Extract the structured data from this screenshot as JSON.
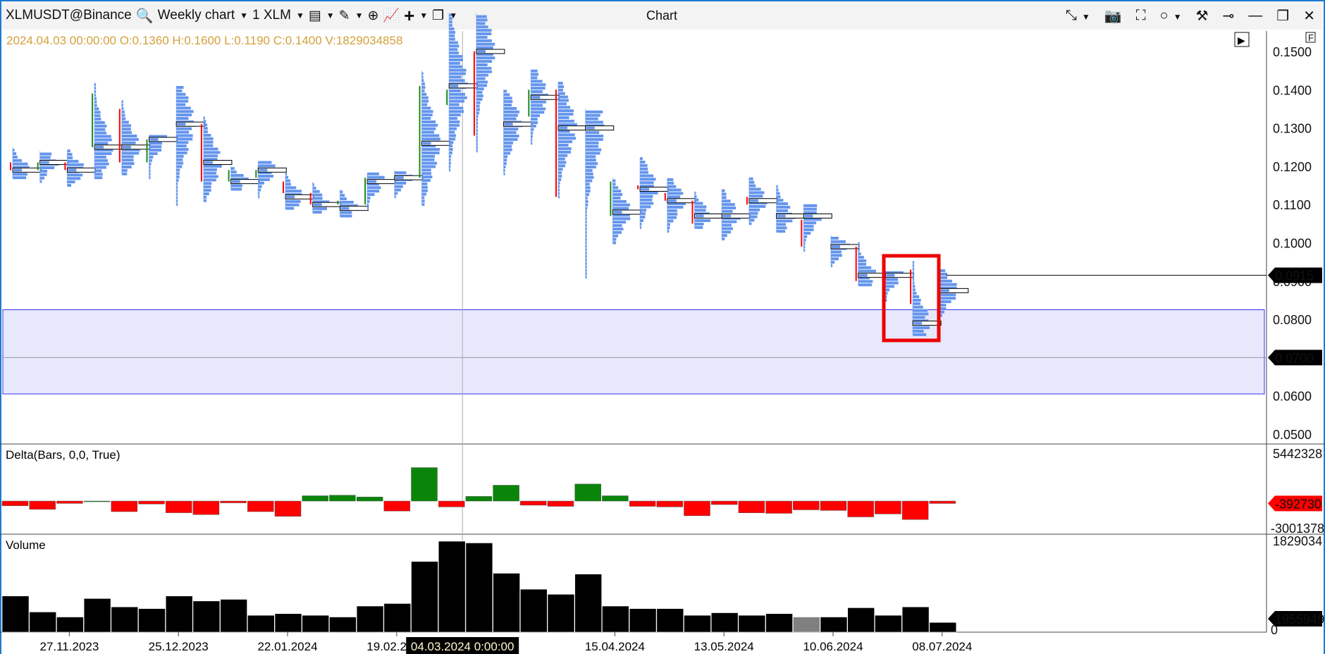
{
  "toolbar": {
    "symbol": "XLMUSDT@Binance",
    "timeframe": "Weekly chart",
    "quantity": "1 XLM",
    "title": "Chart"
  },
  "ohlc_readout": "2024.04.03 00:00:00 O:0.1360 H:0.1600 L:0.1190 C:0.1400 V:1829034858",
  "price_axis": {
    "ticks": [
      "0.1500",
      "0.1400",
      "0.1300",
      "0.1200",
      "0.1100",
      "0.1000",
      "0.0900",
      "0.0800",
      "0.0700",
      "0.0600",
      "0.0500"
    ],
    "last_price_label": "0.0915",
    "level_label": "0.0700"
  },
  "delta_pane": {
    "label": "Delta(Bars, 0,0, True)",
    "max_label": "5442328",
    "min_label": "-3001378",
    "last_label": "-392730"
  },
  "volume_pane": {
    "label": "Volume",
    "max_label": "1829034",
    "last_label": "1955949",
    "zero_label": "0"
  },
  "time_axis": {
    "labels": [
      "27.11.2023",
      "25.12.2023",
      "22.01.2024",
      "19.02.2024",
      "15.04.2024",
      "13.05.2024",
      "10.06.2024",
      "08.07.2024"
    ],
    "crosshair_label": "04.03.2024 0:00:00"
  },
  "colors": {
    "up": "#1a8a1a",
    "down": "#ff0000",
    "profile": "#6495ed",
    "zone_fill": "#e8e8fc",
    "zone_border": "#3333ee",
    "highlight_box": "#ee0000",
    "volume": "#000000",
    "volume_highlight": "#808080"
  },
  "zone": {
    "top": 0.0825,
    "bottom": 0.0605,
    "mid": 0.07
  },
  "chart_data": {
    "type": "candlestick+volume-profile",
    "columns": [
      "open",
      "high",
      "low",
      "close",
      "poc",
      "volume",
      "delta"
    ],
    "bars": [
      [
        0.121,
        0.125,
        0.117,
        0.119,
        0.119,
        728000,
        -760000
      ],
      [
        0.119,
        0.124,
        0.116,
        0.121,
        0.121,
        406000,
        -1340000
      ],
      [
        0.121,
        0.124,
        0.115,
        0.119,
        0.119,
        305000,
        -380000
      ],
      [
        0.125,
        0.142,
        0.117,
        0.139,
        0.125,
        677000,
        0
      ],
      [
        0.135,
        0.137,
        0.118,
        0.121,
        0.125,
        508000,
        -1720000
      ],
      [
        0.121,
        0.128,
        0.117,
        0.127,
        0.127,
        474000,
        -480000
      ],
      [
        0.131,
        0.141,
        0.11,
        0.131,
        0.131,
        728000,
        -1900000
      ],
      [
        0.131,
        0.133,
        0.111,
        0.116,
        0.121,
        627000,
        -2200000
      ],
      [
        0.116,
        0.12,
        0.114,
        0.119,
        0.116,
        660000,
        -290000
      ],
      [
        0.117,
        0.121,
        0.112,
        0.119,
        0.119,
        339000,
        -1720000
      ],
      [
        0.116,
        0.118,
        0.109,
        0.113,
        0.112,
        373000,
        -2480000
      ],
      [
        0.113,
        0.116,
        0.108,
        0.11,
        0.11,
        339000,
        860000
      ],
      [
        0.11,
        0.114,
        0.107,
        0.111,
        0.109,
        305000,
        955000
      ],
      [
        0.11,
        0.118,
        0.109,
        0.117,
        0.116,
        525000,
        670000
      ],
      [
        0.117,
        0.119,
        0.112,
        0.117,
        0.117,
        576000,
        -1620000
      ],
      [
        0.117,
        0.145,
        0.11,
        0.141,
        0.126,
        1423000,
        5442328
      ],
      [
        0.136,
        0.16,
        0.119,
        0.14,
        0.141,
        1829034,
        -950000
      ],
      [
        0.15,
        0.16,
        0.124,
        0.128,
        0.15,
        1795000,
        760000
      ],
      [
        0.131,
        0.14,
        0.118,
        0.131,
        0.131,
        1185000,
        2580000
      ],
      [
        0.133,
        0.145,
        0.126,
        0.14,
        0.138,
        864000,
        -670000
      ],
      [
        0.14,
        0.142,
        0.112,
        0.112,
        0.13,
        762000,
        -860000
      ],
      [
        0.13,
        0.135,
        0.091,
        0.13,
        0.13,
        1169000,
        2770000
      ],
      [
        0.107,
        0.117,
        0.1,
        0.116,
        0.108,
        525000,
        860000
      ],
      [
        0.115,
        0.122,
        0.104,
        0.114,
        0.114,
        474000,
        -860000
      ],
      [
        0.113,
        0.117,
        0.103,
        0.111,
        0.111,
        474000,
        -950000
      ],
      [
        0.111,
        0.113,
        0.104,
        0.105,
        0.107,
        339000,
        -2390000
      ],
      [
        0.107,
        0.114,
        0.101,
        0.107,
        0.107,
        390000,
        -570000
      ],
      [
        0.112,
        0.117,
        0.105,
        0.11,
        0.111,
        339000,
        -1910000
      ],
      [
        0.107,
        0.115,
        0.103,
        0.107,
        0.107,
        373000,
        -2000000
      ],
      [
        0.106,
        0.11,
        0.098,
        0.099,
        0.107,
        305000,
        -1430000
      ],
      [
        0.099,
        0.102,
        0.094,
        0.099,
        0.099,
        305000,
        -1530000
      ],
      [
        0.099,
        0.1,
        0.089,
        0.09,
        0.0915,
        491000,
        -2580000
      ],
      [
        0.09,
        0.093,
        0.085,
        0.092,
        0.0915,
        339000,
        -2100000
      ],
      [
        0.093,
        0.095,
        0.076,
        0.084,
        0.079,
        508000,
        -3001378
      ],
      [
        0.084,
        0.093,
        0.081,
        0.0915,
        0.0875,
        195595,
        -392730
      ]
    ],
    "highlight_volume_index": 29,
    "crosshair_index": 16,
    "first_label_index": 2,
    "label_step": 4
  }
}
